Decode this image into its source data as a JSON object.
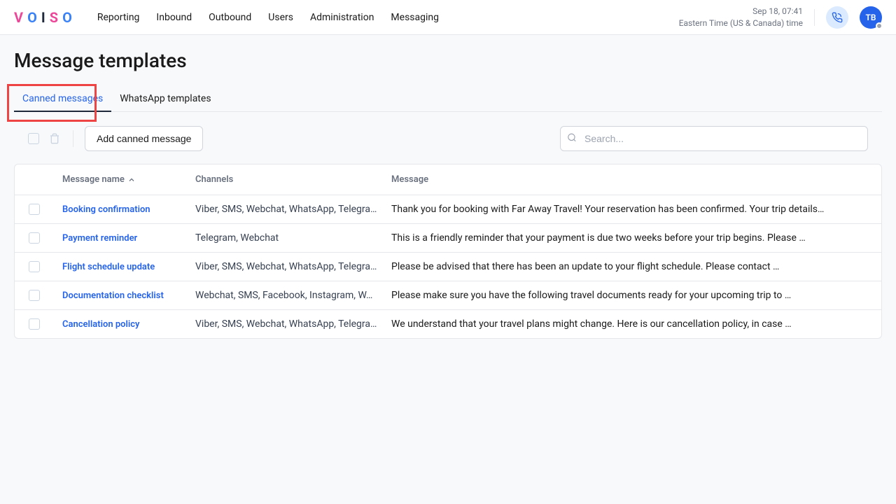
{
  "header": {
    "logo_letters": [
      "V",
      "O",
      "I",
      "S",
      "O"
    ],
    "nav": [
      "Reporting",
      "Inbound",
      "Outbound",
      "Users",
      "Administration",
      "Messaging"
    ],
    "datetime_line1": "Sep 18, 07:41",
    "datetime_line2": "Eastern Time (US & Canada) time",
    "avatar_initials": "TB"
  },
  "page": {
    "title": "Message templates"
  },
  "tabs": [
    {
      "label": "Canned messages",
      "active": true
    },
    {
      "label": "WhatsApp templates",
      "active": false
    }
  ],
  "toolbar": {
    "add_label": "Add canned message",
    "search_placeholder": "Search..."
  },
  "table": {
    "headers": {
      "name": "Message name",
      "channels": "Channels",
      "message": "Message"
    },
    "rows": [
      {
        "name": "Booking confirmation",
        "channels": "Viber, SMS, Webchat, WhatsApp, Telegra…",
        "message": "Thank you for booking with Far Away Travel! Your reservation has been confirmed. Your trip details…"
      },
      {
        "name": "Payment reminder",
        "channels": "Telegram, Webchat",
        "message": "This is a friendly reminder that your payment is due two weeks before your trip begins. Please …"
      },
      {
        "name": "Flight schedule update",
        "channels": "Viber, SMS, Webchat, WhatsApp, Telegra…",
        "message": "Please be advised that there has been an update to your flight schedule. Please contact …"
      },
      {
        "name": "Documentation checklist",
        "channels": "Webchat, SMS, Facebook, Instagram, W…",
        "message": "Please make sure you have the following travel documents ready for your upcoming trip to …"
      },
      {
        "name": "Cancellation policy",
        "channels": "Viber, SMS, Webchat, WhatsApp, Telegra…",
        "message": "We understand that your travel plans might change. Here is our cancellation policy, in case …"
      }
    ]
  }
}
